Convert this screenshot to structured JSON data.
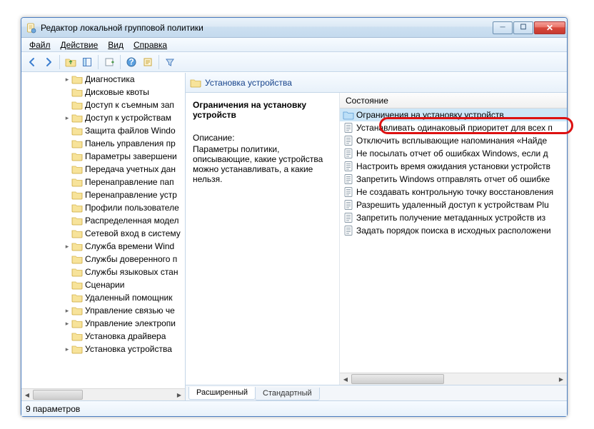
{
  "window": {
    "title": "Редактор локальной групповой политики"
  },
  "menu": {
    "file": "Файл",
    "action": "Действие",
    "view": "Вид",
    "help": "Справка"
  },
  "toolbar": {
    "back": "back",
    "forward": "forward",
    "up": "up",
    "show_hide": "show-hide-tree",
    "export": "export-list",
    "help": "help",
    "prop": "properties",
    "filter": "filter"
  },
  "tree": {
    "items": [
      {
        "label": "Диагностика",
        "expander": "▸"
      },
      {
        "label": "Дисковые квоты",
        "expander": ""
      },
      {
        "label": "Доступ к съемным зап",
        "expander": ""
      },
      {
        "label": "Доступ к устройствам",
        "expander": "▸"
      },
      {
        "label": "Защита файлов Windo",
        "expander": ""
      },
      {
        "label": "Панель управления пр",
        "expander": ""
      },
      {
        "label": "Параметры завершени",
        "expander": ""
      },
      {
        "label": "Передача учетных дан",
        "expander": ""
      },
      {
        "label": "Перенаправление пап",
        "expander": ""
      },
      {
        "label": "Перенаправление устр",
        "expander": ""
      },
      {
        "label": "Профили пользователе",
        "expander": ""
      },
      {
        "label": "Распределенная модел",
        "expander": ""
      },
      {
        "label": "Сетевой вход в систему",
        "expander": ""
      },
      {
        "label": "Служба времени Wind",
        "expander": "▸"
      },
      {
        "label": "Службы доверенного п",
        "expander": ""
      },
      {
        "label": "Службы языковых стан",
        "expander": ""
      },
      {
        "label": "Сценарии",
        "expander": ""
      },
      {
        "label": "Удаленный помощник",
        "expander": ""
      },
      {
        "label": "Управление связью че",
        "expander": "▸"
      },
      {
        "label": "Управление электропи",
        "expander": "▸"
      },
      {
        "label": "Установка драйвера",
        "expander": ""
      },
      {
        "label": "Установка устройства",
        "expander": "▸"
      }
    ]
  },
  "header": {
    "title": "Установка устройства"
  },
  "description": {
    "title": "Ограничения на установку устройств",
    "label": "Описание:",
    "text": "Параметры политики, описывающие, какие устройства можно устанавливать, а какие нельзя."
  },
  "list": {
    "column": "Состояние",
    "rows": [
      {
        "icon": "folder",
        "text": "Ограничения на установку устройств",
        "selected": true
      },
      {
        "icon": "policy",
        "text": "Устанавливать одинаковый приоритет для всех п"
      },
      {
        "icon": "policy",
        "text": "Отключить всплывающие напоминания «Найде"
      },
      {
        "icon": "policy",
        "text": "Не посылать отчет об ошибках Windows, если д"
      },
      {
        "icon": "policy",
        "text": "Настроить время ожидания установки устройств"
      },
      {
        "icon": "policy",
        "text": "Запретить Windows отправлять отчет об ошибке"
      },
      {
        "icon": "policy",
        "text": "Не создавать контрольную точку восстановления"
      },
      {
        "icon": "policy",
        "text": "Разрешить удаленный доступ к устройствам Plu"
      },
      {
        "icon": "policy",
        "text": "Запретить получение метаданных устройств из"
      },
      {
        "icon": "policy",
        "text": "Задать порядок поиска в исходных расположени"
      }
    ]
  },
  "tabs": {
    "extended": "Расширенный",
    "standard": "Стандартный"
  },
  "status": {
    "text": "9 параметров"
  }
}
